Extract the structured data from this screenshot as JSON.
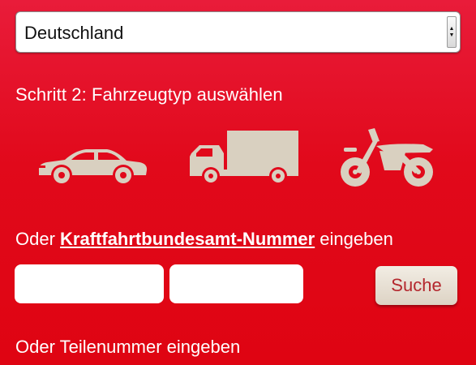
{
  "country_select": {
    "selected_value": "Deutschland"
  },
  "step2": {
    "label": "Schritt 2: Fahrzeugtyp auswählen",
    "vehicles": [
      {
        "icon": "car-icon"
      },
      {
        "icon": "truck-icon"
      },
      {
        "icon": "motorcycle-icon"
      }
    ]
  },
  "kba": {
    "prefix": "Oder ",
    "link_label": "Kraftfahrtbundesamt-Nummer",
    "suffix": " eingeben",
    "input1_value": "",
    "input2_value": "",
    "search_label": "Suche"
  },
  "parts": {
    "label": "Oder Teilenummer eingeben"
  },
  "colors": {
    "background": "#e1091b",
    "icon_fill": "#d9d0c0",
    "button_text": "#b4272d"
  }
}
